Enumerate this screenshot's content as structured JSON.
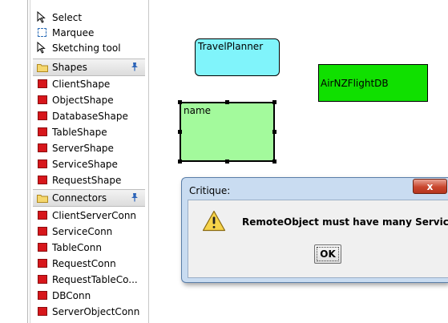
{
  "palette": {
    "tools": [
      {
        "label": "Select",
        "icon": "arrow-pointer-icon"
      },
      {
        "label": "Marquee",
        "icon": "marquee-icon"
      },
      {
        "label": "Sketching tool",
        "icon": "arrow-pointer-icon"
      }
    ],
    "shapes_drawer": {
      "label": "Shapes",
      "icon": "folder-icon"
    },
    "shapes": [
      "ClientShape",
      "ObjectShape",
      "DatabaseShape",
      "TableShape",
      "ServerShape",
      "ServiceShape",
      "RequestShape"
    ],
    "connectors_drawer": {
      "label": "Connectors",
      "icon": "folder-icon"
    },
    "connectors": [
      "ClientServerConn",
      "ServiceConn",
      "TableConn",
      "RequestConn",
      "RequestTableCo...",
      "DBConn",
      "ServerObjectConn"
    ]
  },
  "canvas": {
    "travel_planner": "TravelPlanner",
    "airnz": "AirNZFlightDB",
    "name_shape": "name",
    "colors": {
      "travel": "#80f4fb",
      "airnz": "#10e000",
      "name": "#a3fa9c"
    }
  },
  "dialog": {
    "title": "Critique:",
    "close": "x",
    "message": "RemoteObject must have  many Service",
    "ok": "OK"
  }
}
